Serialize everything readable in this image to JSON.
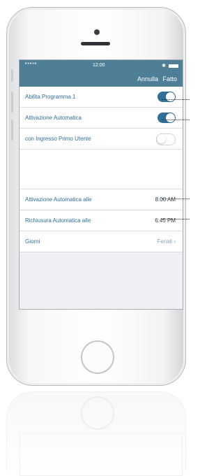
{
  "status": {
    "signal_dots": "•••••",
    "time": "12:00",
    "bluetooth": "✱"
  },
  "nav": {
    "cancel": "Annulla",
    "done": "Fatto"
  },
  "settings": {
    "row1_label": "Abilita Programma 1",
    "row2_label": "Attivazione Automatica",
    "row3_label": "con Ingresso Primo Utente",
    "toggles": {
      "row1": true,
      "row2": true,
      "row3": false
    }
  },
  "schedule": {
    "activation_label": "Attivazione Automatica alle",
    "activation_value": "8:00 AM",
    "closing_label": "Richiusura Automatica alle",
    "closing_value": "6:45 PM",
    "days_label": "Giorni",
    "days_value": "Feriali",
    "chevron": "›"
  },
  "colors": {
    "nav_bar": "#4e7f97",
    "accent": "#2f6f9a"
  }
}
